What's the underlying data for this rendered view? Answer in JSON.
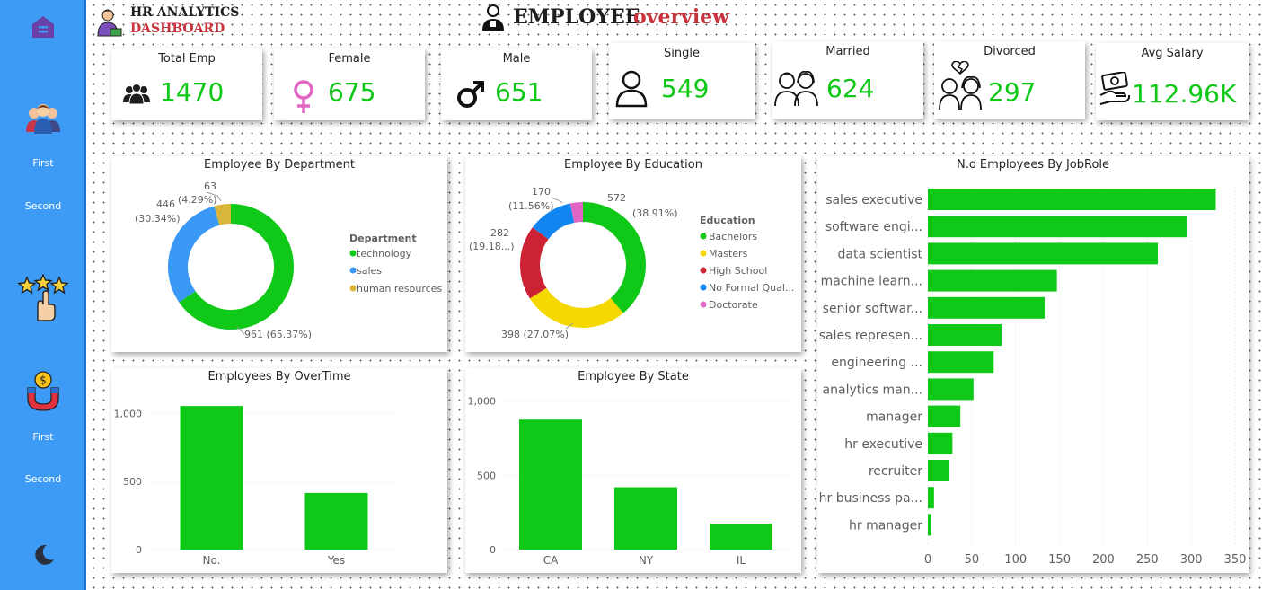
{
  "header": {
    "logo_line1": "HR ANALYTICS",
    "logo_line2": "DASHBOARD",
    "title_part1": "EMPLOYEE",
    "title_part2": "overview"
  },
  "sidebar": {
    "items": [
      {
        "icon": "home-icon"
      },
      {
        "icon": "people-icon"
      },
      {
        "label": "First"
      },
      {
        "label": "Second"
      },
      {
        "icon": "star-rating-icon"
      },
      {
        "icon": "money-magnet-icon"
      },
      {
        "label": "First"
      },
      {
        "label": "Second"
      },
      {
        "icon": "moon-icon"
      }
    ]
  },
  "kpis": [
    {
      "label": "Total Emp",
      "value": "1470",
      "icon": "people-icon"
    },
    {
      "label": "Female",
      "value": "675",
      "icon": "female-icon"
    },
    {
      "label": "Male",
      "value": "651",
      "icon": "male-icon"
    },
    {
      "label": "Single",
      "value": "549",
      "icon": "person-icon"
    },
    {
      "label": "Married",
      "value": "624",
      "icon": "couple-icon"
    },
    {
      "label": "Divorced",
      "value": "297",
      "icon": "broken-heart-icon"
    },
    {
      "label": "Avg Salary",
      "value": "112.96K",
      "icon": "salary-icon"
    }
  ],
  "colors": {
    "green": "#10c818",
    "blue": "#3a99f5",
    "gold": "#d9b53a",
    "red": "#cc2233",
    "yellow": "#f5d800",
    "azure": "#1185f0",
    "pink": "#e266c4",
    "accent_red": "#c8323c"
  },
  "chart_data": [
    {
      "type": "pie",
      "title": "Employee By Department",
      "legend_title": "Department",
      "categories": [
        "technology",
        "sales",
        "human resources"
      ],
      "values": [
        961,
        446,
        63
      ],
      "labels": [
        "961 (65.37%)",
        "446",
        "(30.34%)",
        "63",
        "(4.29%)"
      ],
      "legend": "right"
    },
    {
      "type": "pie",
      "title": "Employee By Education",
      "legend_title": "Education",
      "categories": [
        "Bachelors",
        "Masters",
        "High School",
        "No Formal Qual...",
        "Doctorate"
      ],
      "values": [
        572,
        398,
        282,
        170,
        48
      ],
      "labels": [
        "572",
        "(38.91%)",
        "398 (27.07%)",
        "282",
        "(19.18...)",
        "170",
        "(11.56%)"
      ],
      "legend": "right"
    },
    {
      "type": "bar",
      "title": "Employees By OverTime",
      "categories": [
        "No.",
        "Yes"
      ],
      "values": [
        1054,
        416
      ],
      "yticks": [
        "0",
        "500",
        "1,000"
      ],
      "ylim": [
        0,
        1200
      ]
    },
    {
      "type": "bar",
      "title": "Employee By State",
      "categories": [
        "CA",
        "NY",
        "IL"
      ],
      "values": [
        875,
        420,
        175
      ],
      "yticks": [
        "0",
        "500",
        "1,000"
      ],
      "ylim": [
        0,
        1100
      ]
    },
    {
      "type": "bar",
      "orientation": "horizontal",
      "title": "N.o Employees By JobRole",
      "categories": [
        "sales executive",
        "software engi...",
        "data scientist",
        "machine learn...",
        "senior softwar...",
        "sales represen...",
        "engineering ...",
        "analytics man...",
        "manager",
        "hr executive",
        "recruiter",
        "hr business pa...",
        "hr manager"
      ],
      "values": [
        328,
        295,
        262,
        147,
        133,
        84,
        75,
        52,
        37,
        28,
        24,
        7,
        4
      ],
      "xticks": [
        "0",
        "50",
        "100",
        "150",
        "200",
        "250",
        "300",
        "350"
      ],
      "xlim": [
        0,
        350
      ]
    }
  ]
}
